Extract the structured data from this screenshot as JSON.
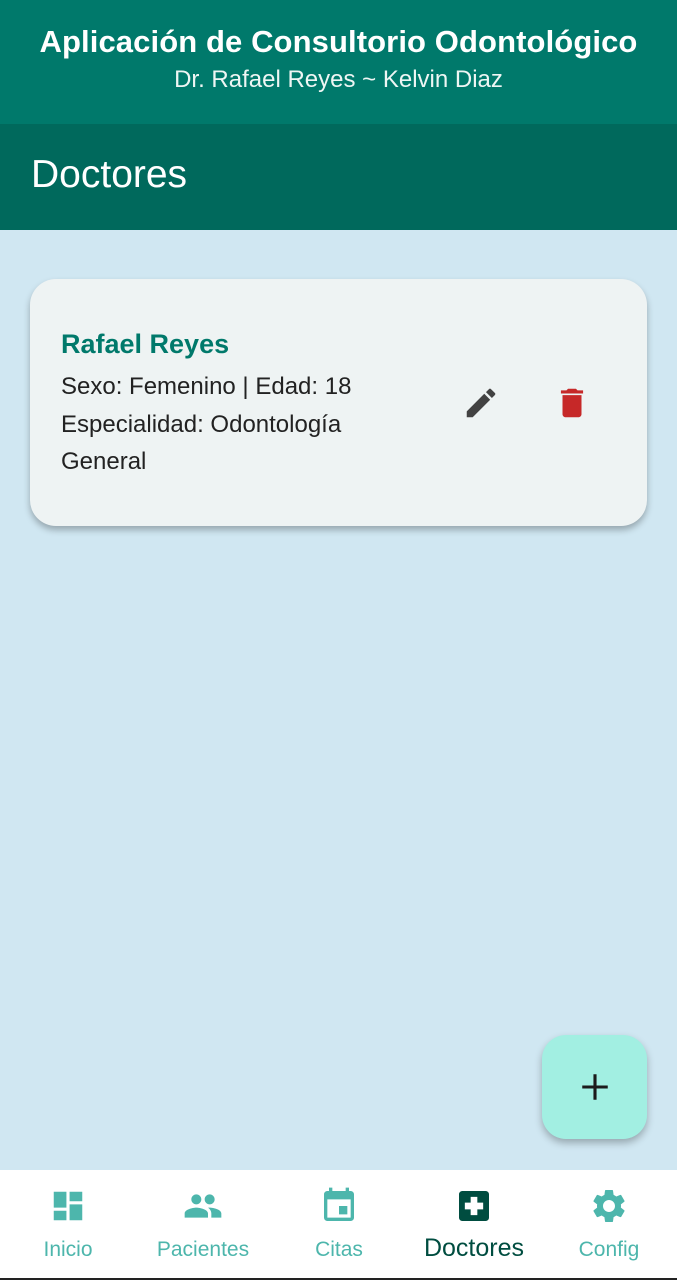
{
  "header": {
    "title": "Aplicación de Consultorio Odontológico",
    "subtitle": "Dr. Rafael Reyes ~ Kelvin Diaz"
  },
  "page": {
    "title": "Doctores"
  },
  "doctors": [
    {
      "name": "Rafael Reyes",
      "line1": "Sexo: Femenino | Edad: 18",
      "line2": "Especialidad: Odontología",
      "line3": "General"
    }
  ],
  "actions": {
    "edit_icon": "pencil-icon",
    "delete_icon": "trash-icon",
    "add_icon": "plus-icon"
  },
  "nav": {
    "items": [
      {
        "label": "Inicio",
        "icon": "dashboard-icon"
      },
      {
        "label": "Pacientes",
        "icon": "people-icon"
      },
      {
        "label": "Citas",
        "icon": "calendar-icon"
      },
      {
        "label": "Doctores",
        "icon": "medical-cross-icon"
      },
      {
        "label": "Config",
        "icon": "gear-icon"
      }
    ],
    "active_index": 3
  },
  "colors": {
    "header": "#00796b",
    "page_bar": "#00695c",
    "background": "#d0e7f2",
    "accent": "#4db6ac",
    "active_nav": "#004d40",
    "delete": "#c62828",
    "fab": "#a2efe2"
  }
}
